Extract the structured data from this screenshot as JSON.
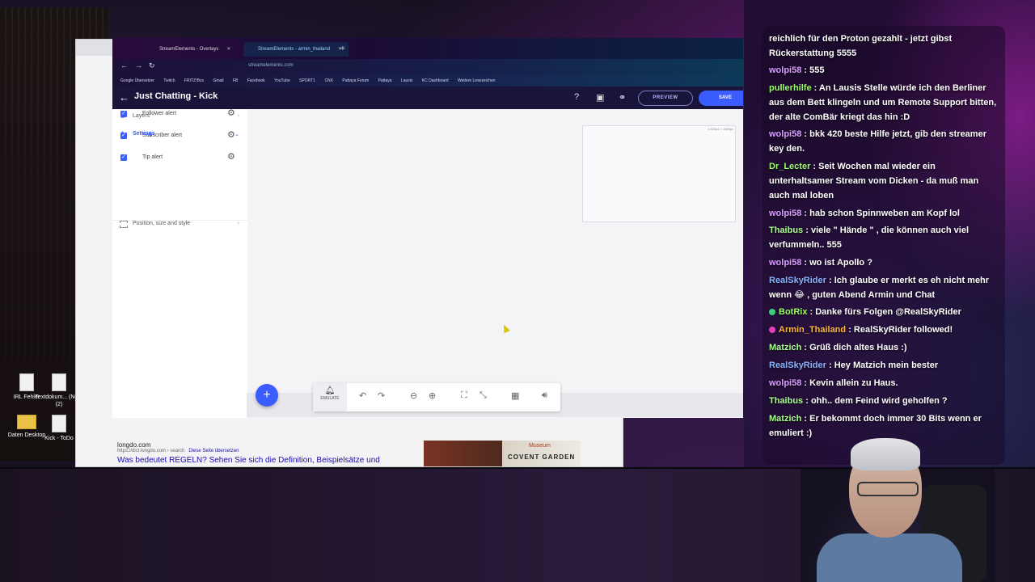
{
  "desktop": {
    "icons": [
      {
        "label": "IRL Fehler"
      },
      {
        "label": "Textdokum... (Neu) (2)"
      },
      {
        "label": "Daten Desktop"
      },
      {
        "label": "Kick - ToDo"
      }
    ]
  },
  "back_browser": {
    "result_site": "longdo.com",
    "result_url": "https://dict.longdo.com › search",
    "result_translate": "Diese Seite übersetzen",
    "result_title": "Was bedeutet REGELN? Sehen Sie sich die Definition, Beispielsätze und",
    "image_label": "COVENT GARDEN",
    "image_museum": "Museum"
  },
  "browser": {
    "tabs": [
      {
        "label": "StreamElements - Overlays"
      },
      {
        "label": "StreamElements - armin_thailand"
      }
    ],
    "url": "streamelements.com",
    "bookmarks": [
      "Google Übersetzer",
      "Twitch",
      "FRITZ!Box",
      "Gmail",
      "FB",
      "Facebook",
      "YouTube",
      "SPORT1",
      "CNX",
      "Pattaya Forum",
      "Pattaya",
      "Lausis",
      "KC Dashboard",
      "Weitere Lesezeichen"
    ]
  },
  "editor": {
    "title": "Just Chatting - Kick",
    "preview_label": "PREVIEW",
    "save_label": "SAVE",
    "layers_label": "Layers",
    "settings_label": "Settings",
    "alerts": [
      {
        "label": "Follower alert",
        "checked": true
      },
      {
        "label": "Subscriber alert",
        "checked": true
      },
      {
        "label": "Tip alert",
        "checked": true
      }
    ],
    "position_label": "Position, size and style",
    "canvas_size": "1,920px × 1080px",
    "emulate_label": "EMULATE"
  },
  "chat": {
    "messages": [
      {
        "user": "",
        "text": "reichlich für den Proton gezahlt - jetzt gibst Rückerstattung 5555",
        "color": "#ffffff"
      },
      {
        "user": "wolpi58",
        "text": ": 555",
        "color": "#d9a0ff"
      },
      {
        "user": "pullerhilfe",
        "text": ": An Lausis Stelle würde ich den Berliner aus dem Bett klingeln und um Remote Support bitten, der alte ComBär kriegt das hin :D",
        "color": "#9cff6a"
      },
      {
        "user": "wolpi58",
        "text": ": bkk 420 beste Hilfe jetzt, gib den streamer key den.",
        "color": "#d9a0ff"
      },
      {
        "user": "Dr_Lecter",
        "text": ": Seit Wochen mal wieder ein unterhaltsamer Stream vom Dicken - da muß man auch mal loben",
        "color": "#9cff6a"
      },
      {
        "user": "wolpi58",
        "text": ": hab schon Spinnweben am Kopf lol",
        "color": "#d9a0ff"
      },
      {
        "user": "Thaibus",
        "text": ": viele \" Hände \" , die können auch viel verfummeln.. 555",
        "color": "#a6ff8a"
      },
      {
        "user": "wolpi58",
        "text": ": wo ist Apollo ?",
        "color": "#d9a0ff"
      },
      {
        "user": "RealSkyRider",
        "text": ": Ich glaube er merkt es eh nicht mehr wenn 😂 , guten Abend Armin und Chat",
        "color": "#8ab4ff"
      },
      {
        "user": "BotRix",
        "text": ": Danke fürs Folgen @RealSkyRider",
        "color": "#9cff6a"
      },
      {
        "user": "Armin_Thailand",
        "text": ": RealSkyRider followed!",
        "color": "#ffb347"
      },
      {
        "user": "Matzich",
        "text": ": Grüß dich altes Haus :)",
        "color": "#a6ff8a"
      },
      {
        "user": "RealSkyRider",
        "text": ": Hey Matzich mein bester",
        "color": "#8ab4ff"
      },
      {
        "user": "wolpi58",
        "text": ": Kevin allein zu Haus.",
        "color": "#d9a0ff"
      },
      {
        "user": "Thaibus",
        "text": ": ohh.. dem Feind wird geholfen ?",
        "color": "#a6ff8a"
      },
      {
        "user": "Matzich",
        "text": ": Er bekommt doch immer 30 Bits wenn er emuliert :)",
        "color": "#a6ff8a"
      }
    ]
  },
  "colors": {
    "accent": "#3b5cff",
    "header_bg": "#19143a"
  }
}
